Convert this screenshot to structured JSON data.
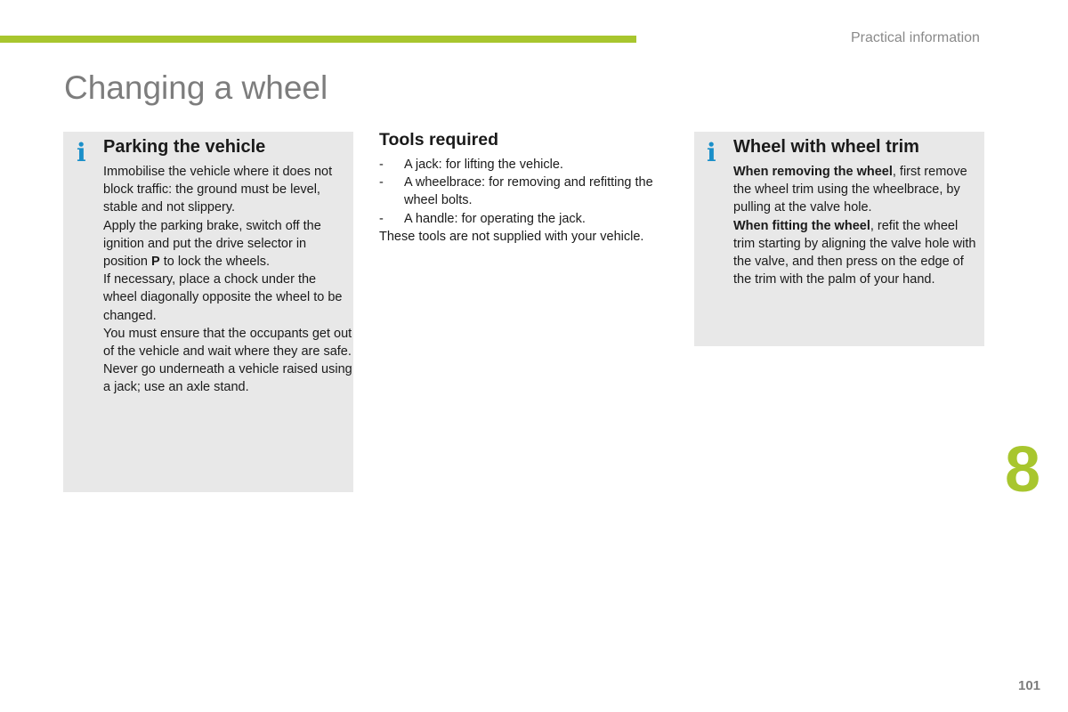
{
  "header": {
    "section_title": "Practical information",
    "accent_color": "#a8c62e"
  },
  "page_title": "Changing a wheel",
  "parking_box": {
    "icon": "info-icon",
    "icon_glyph": "i",
    "heading": "Parking the vehicle",
    "paragraphs": {
      "p1": "Immobilise the vehicle where it does not block traffic: the ground must be level, stable and not slippery.",
      "p2_before": "Apply the parking brake, switch off the ignition and put the drive selector in position ",
      "p2_bold": "P",
      "p2_after": " to lock the wheels.",
      "p3": "If necessary, place a chock under the wheel diagonally opposite the wheel to be changed.",
      "p4": "You must ensure that the occupants get out of the vehicle and wait where they are safe.",
      "p5": "Never go underneath a vehicle raised using a jack; use an axle stand."
    }
  },
  "tools": {
    "heading": "Tools required",
    "bullet": "-",
    "items": [
      "A jack: for lifting the vehicle.",
      "A wheelbrace: for removing and refitting the wheel bolts.",
      "A handle: for operating the jack."
    ],
    "note": "These tools are not supplied with your vehicle."
  },
  "trim_box": {
    "icon": "info-icon",
    "icon_glyph": "i",
    "heading": "Wheel with wheel trim",
    "p1_bold": "When removing the wheel",
    "p1_rest": ", first remove the wheel trim using the wheelbrace, by pulling at the valve hole.",
    "p2_bold": "When fitting the wheel",
    "p2_rest": ", refit the wheel trim starting by aligning the valve hole with the valve, and then press on the edge of the trim with the palm of your hand."
  },
  "chapter_number": "8",
  "page_number": "101"
}
